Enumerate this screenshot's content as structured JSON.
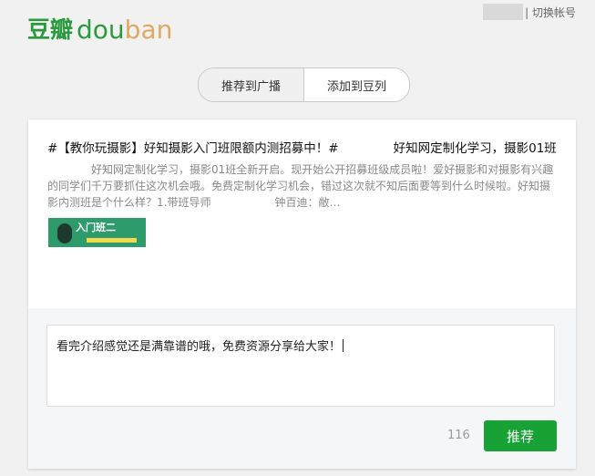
{
  "header": {
    "logo_cn": "豆瓣",
    "logo_en_a": "dou",
    "logo_en_b": "ban",
    "switch_account": "| 切换帐号"
  },
  "tabs": [
    {
      "label": "推荐到广播",
      "active": false
    },
    {
      "label": "添加到豆列",
      "active": true
    }
  ],
  "share": {
    "title_a": "#【教你玩摄影】好知摄影入门班限额内测招募中！#",
    "title_b": "好知网定制化学习，摄影01班",
    "desc_a": "好知网定制化学习，摄影01班全新开启。现开始公开招募班级成员啦！爱好摄影和对摄影有兴趣的同学们千万要抓住这次机会哦。免费定制化学习机会，错过这次就不知后面要等到什么时候啦。好知摄影内测班是个什么样？1.带班导师",
    "desc_b": "钟百迪：敝…",
    "thumb_text": "入门班二"
  },
  "comment": {
    "text": "看完介绍感觉还是满靠谱的哦，免费资源分享给大家！",
    "count": "116",
    "submit_label": "推荐"
  },
  "colors": {
    "brand_green": "#2b9a3f",
    "logo_orange": "#e1a95f",
    "button_green": "#18a135"
  }
}
